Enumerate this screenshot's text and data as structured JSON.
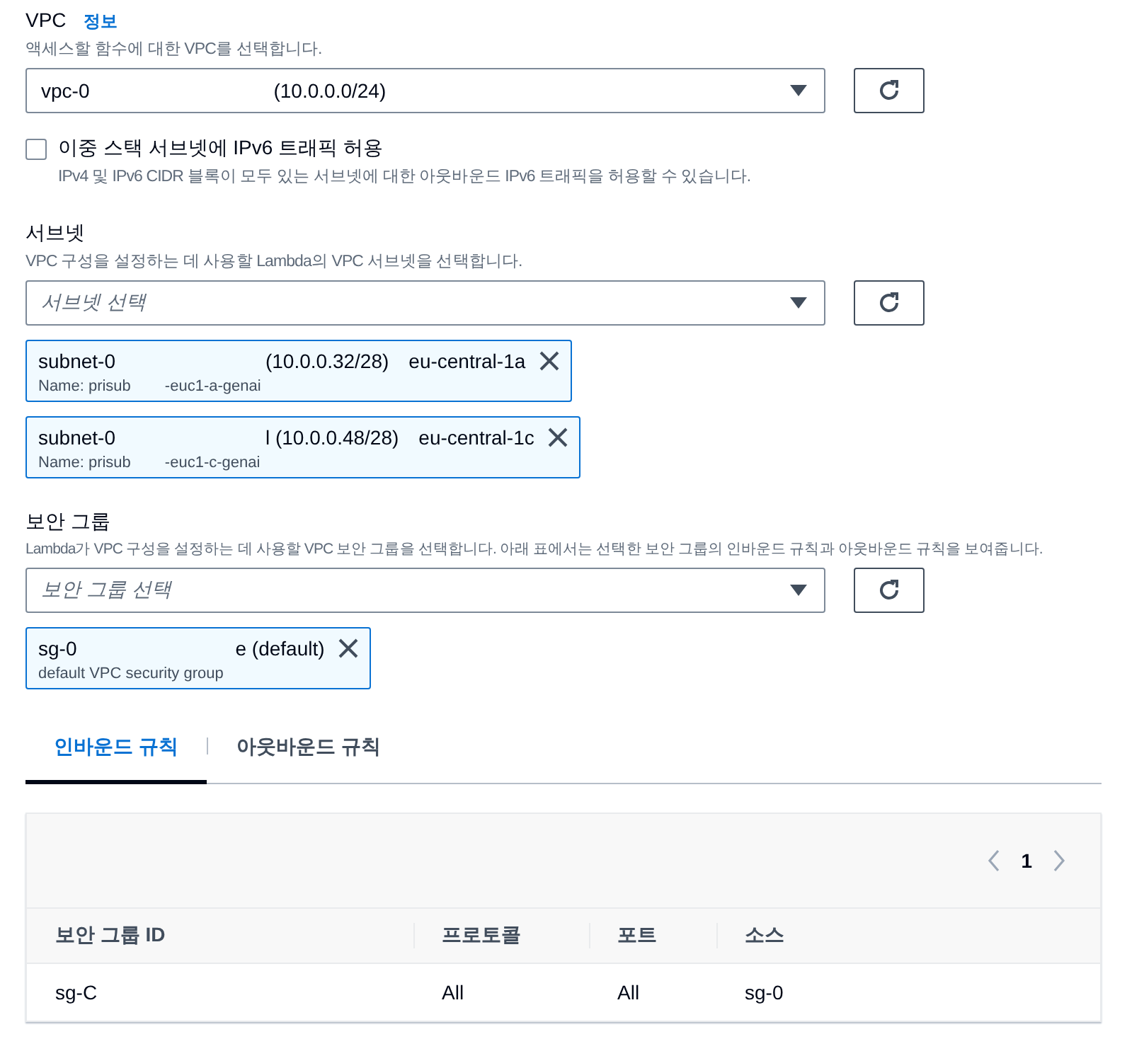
{
  "vpc": {
    "label": "VPC",
    "info_link": "정보",
    "description": "액세스할 함수에 대한 VPC를 선택합니다.",
    "select": {
      "value_parts": [
        "vpc-0",
        "(10.0.0.0/24)"
      ]
    }
  },
  "dual_stack": {
    "label": "이중 스택 서브넷에 IPv6 트래픽 허용",
    "description": "IPv4 및 IPv6 CIDR 블록이 모두 있는 서브넷에 대한 아웃바운드 IPv6 트래픽을 허용할 수 있습니다.",
    "checked": false
  },
  "subnets": {
    "label": "서브넷",
    "description": "VPC 구성을 설정하는 데 사용할 Lambda의 VPC 서브넷을 선택합니다.",
    "select": {
      "placeholder": "서브넷 선택"
    },
    "tokens": [
      {
        "title_parts": [
          "subnet-0",
          "(10.0.0.32/28)",
          "eu-central-1a"
        ],
        "name_parts": [
          "Name: prisub",
          "-euc1-a-genai"
        ]
      },
      {
        "title_parts": [
          "subnet-0",
          "l (10.0.0.48/28)",
          "eu-central-1c"
        ],
        "name_parts": [
          "Name: prisub",
          "-euc1-c-genai"
        ]
      }
    ]
  },
  "security_groups": {
    "label": "보안 그룹",
    "description": "Lambda가 VPC 구성을 설정하는 데 사용할 VPC 보안 그룹을 선택합니다. 아래 표에서는 선택한 보안 그룹의 인바운드 규칙과 아웃바운드 규칙을 보여줍니다.",
    "select": {
      "placeholder": "보안 그룹 선택"
    },
    "tokens": [
      {
        "title_parts": [
          "sg-0",
          "e (default)"
        ],
        "name_parts": [
          "default VPC security group"
        ]
      }
    ]
  },
  "tabs": [
    {
      "label": "인바운드 규칙",
      "selected": true
    },
    {
      "label": "아웃바운드 규칙",
      "selected": false
    }
  ],
  "table": {
    "pagination": {
      "page": "1"
    },
    "columns": [
      "보안 그룹 ID",
      "프로토콜",
      "포트",
      "소스"
    ],
    "rows": [
      [
        "sg-C",
        "All",
        "All",
        "sg-0"
      ]
    ]
  }
}
